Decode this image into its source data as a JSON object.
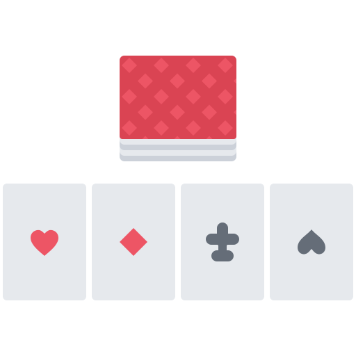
{
  "colors": {
    "background": "#ffffff",
    "deck_back": "#da4453",
    "deck_pattern": "#ed5565",
    "deck_edges_light": "#e6e9ed",
    "deck_edges_dark": "#ccd1d9",
    "card_face": "#e6e9ed",
    "red_suit": "#ed5565",
    "black_suit": "#656d78"
  },
  "icons": {
    "deck": "card-deck-icon",
    "hearts": "heart-icon",
    "diamonds": "diamond-icon",
    "clubs": "club-icon",
    "spades": "spade-icon"
  }
}
